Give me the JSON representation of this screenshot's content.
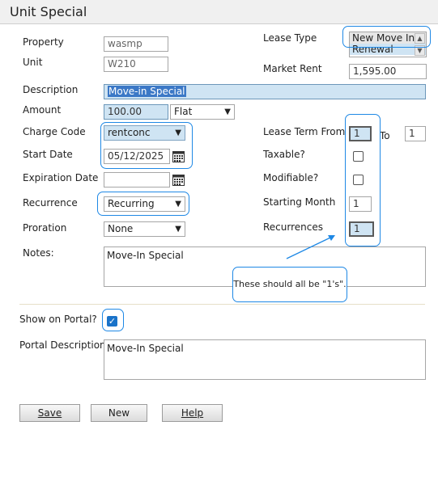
{
  "window": {
    "title": "Unit Special"
  },
  "form": {
    "property": {
      "label": "Property",
      "value": "wasmp"
    },
    "unit": {
      "label": "Unit",
      "value": "W210"
    },
    "description": {
      "label": "Description",
      "value": "Move-in Special"
    },
    "amount": {
      "label": "Amount",
      "value": "100.00",
      "type_value": "Flat"
    },
    "charge_code": {
      "label": "Charge Code",
      "value": "rentconc"
    },
    "start_date": {
      "label": "Start Date",
      "value": "05/12/2025"
    },
    "expiration_date": {
      "label": "Expiration Date",
      "value": ""
    },
    "recurrence": {
      "label": "Recurrence",
      "value": "Recurring"
    },
    "proration": {
      "label": "Proration",
      "value": "None"
    },
    "notes": {
      "label": "Notes:",
      "value": "Move-In Special"
    },
    "lease_type": {
      "label": "Lease Type",
      "options": [
        "New Move In",
        "Renewal"
      ]
    },
    "market_rent": {
      "label": "Market Rent",
      "value": "1,595.00"
    },
    "lease_term": {
      "label": "Lease Term From",
      "from_value": "1",
      "to_label": "To",
      "to_value": "1"
    },
    "taxable": {
      "label": "Taxable?",
      "checked": false
    },
    "modifiable": {
      "label": "Modifiable?",
      "checked": false
    },
    "starting_month": {
      "label": "Starting Month",
      "value": "1"
    },
    "recurrences": {
      "label": "Recurrences",
      "value": "1"
    },
    "show_on_portal": {
      "label": "Show on Portal?",
      "checked": true,
      "checkmark": "✓"
    },
    "portal_description": {
      "label": "Portal Description",
      "value": "Move-In Special"
    }
  },
  "annotation": {
    "callout_text": "These should all be \"1's\"."
  },
  "buttons": {
    "save": "Save",
    "new": "New",
    "help": "Help"
  },
  "colors": {
    "annotation": "#1e88e5",
    "highlight": "#cfe4f3",
    "checkbox": "#1a73c9"
  },
  "icons": {
    "calendar": "calendar-icon",
    "dropdown": "chevron-down-icon"
  }
}
